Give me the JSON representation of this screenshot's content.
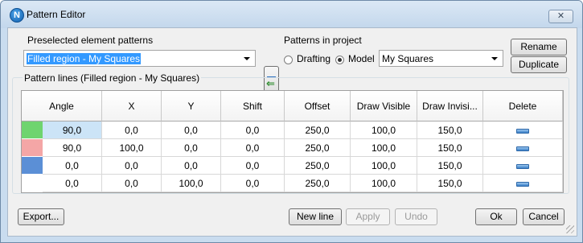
{
  "window": {
    "title": "Pattern Editor",
    "app_icon_letter": "N",
    "close_glyph": "✕"
  },
  "preselected": {
    "label": "Preselected element patterns",
    "value": "Filled region - My Squares"
  },
  "project": {
    "label": "Patterns in project",
    "options": [
      {
        "label": "Drafting",
        "checked": false
      },
      {
        "label": "Model",
        "checked": true
      }
    ],
    "selected_pattern": "My Squares"
  },
  "side_buttons": {
    "rename": "Rename",
    "duplicate": "Duplicate"
  },
  "pattern_lines": {
    "label": "Pattern lines (Filled region - My Squares)",
    "columns": [
      "Angle",
      "X",
      "Y",
      "Shift",
      "Offset",
      "Draw Visible",
      "Draw Invisi...",
      "Delete"
    ],
    "rows": [
      {
        "swatch_color": "#6fd46f",
        "cells": [
          "90,0",
          "0,0",
          "0,0",
          "0,0",
          "250,0",
          "100,0",
          "150,0"
        ]
      },
      {
        "swatch_color": "#f4a6a6",
        "cells": [
          "90,0",
          "100,0",
          "0,0",
          "0,0",
          "250,0",
          "100,0",
          "150,0"
        ]
      },
      {
        "swatch_color": "#5b8fd6",
        "cells": [
          "0,0",
          "0,0",
          "0,0",
          "0,0",
          "250,0",
          "100,0",
          "150,0"
        ]
      },
      {
        "swatch_color": "#ffffff",
        "cells": [
          "0,0",
          "0,0",
          "100,0",
          "0,0",
          "250,0",
          "100,0",
          "150,0"
        ]
      }
    ]
  },
  "bottom_buttons": {
    "export": "Export...",
    "new_line": "New line",
    "apply": "Apply",
    "undo": "Undo",
    "ok": "Ok",
    "cancel": "Cancel"
  }
}
